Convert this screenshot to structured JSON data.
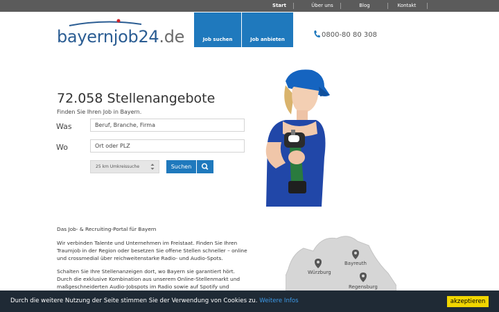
{
  "topnav": {
    "items": [
      {
        "label": "Start",
        "active": true
      },
      {
        "label": "Über uns",
        "active": false
      },
      {
        "label": "Blog",
        "active": false
      },
      {
        "label": "Kontakt",
        "active": false
      }
    ]
  },
  "header": {
    "logo_part1": "bayern",
    "logo_part2": "job24",
    "logo_part3": ".de",
    "tabs": [
      {
        "label": "Job suchen"
      },
      {
        "label": "Job anbieten"
      }
    ],
    "phone": "0800-80 80 308",
    "colors": {
      "brand_blue": "#1f79bd",
      "logo_blue": "#2b5d93",
      "logo_red": "#d0232a"
    }
  },
  "hero": {
    "title": "72.058 Stellenangebote",
    "subtitle": "Finden Sie Ihren Job in Bayern.",
    "was_label": "Was",
    "was_placeholder": "Beruf, Branche, Firma",
    "wo_label": "Wo",
    "wo_placeholder": "Ort oder PLZ",
    "radius_value": "25 km Umkreissuche",
    "search_label": "Suchen"
  },
  "intro": {
    "heading": "Das Job- & Recruiting-Portal für Bayern",
    "para1": "Wir verbinden Talente und Unternehmen im Freistaat. Finden Sie Ihren Traumjob in der Region oder besetzen Sie offene Stellen schneller – online und crossmedial über reichweitenstarke Radio- und Audio-Spots.",
    "para2": "Schalten Sie Ihre Stellenanzeigen dort, wo Bayern sie garantiert hört. Durch die exklusive Kombination aus unserem Online-Stellenmarkt und maßgeschneiderten Audio-Jobspots im Radio sowie auf Spotify und"
  },
  "map": {
    "cities": [
      "Würzburg",
      "Bayreuth",
      "Regensburg"
    ]
  },
  "cookie": {
    "text": "Durch die weitere Nutzung der Seite stimmen Sie der Verwendung von Cookies zu.",
    "link": "Weitere Infos",
    "button": "akzeptieren"
  }
}
